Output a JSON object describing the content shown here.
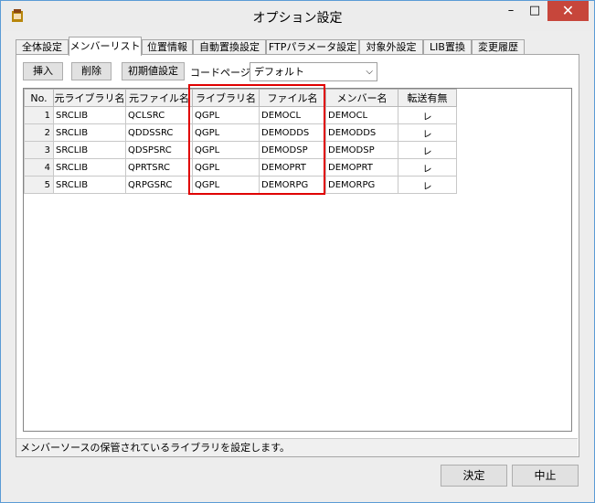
{
  "window": {
    "title": "オプション設定",
    "minimize": "–",
    "maximize": "□",
    "close": "✕"
  },
  "tabs": [
    {
      "label": "全体設定",
      "active": false
    },
    {
      "label": "メンバーリスト",
      "active": true
    },
    {
      "label": "位置情報",
      "active": false
    },
    {
      "label": "自動置換設定",
      "active": false
    },
    {
      "label": "FTPパラメータ設定",
      "active": false
    },
    {
      "label": "対象外設定",
      "active": false
    },
    {
      "label": "LIB置換",
      "active": false
    },
    {
      "label": "変更履歴",
      "active": false
    }
  ],
  "toolbar": {
    "insert_label": "挿入",
    "delete_label": "削除",
    "init_label": "初期値設定",
    "codepage_label": "コードページ",
    "codepage_value": "デフォルト"
  },
  "grid": {
    "columns": [
      "No.",
      "元ライブラリ名",
      "元ファイル名",
      "ライブラリ名",
      "ファイル名",
      "メンバー名",
      "転送有無"
    ],
    "rows": [
      [
        "1",
        "SRCLIB",
        "QCLSRC",
        "QGPL",
        "DEMOCL",
        "DEMOCL",
        "レ"
      ],
      [
        "2",
        "SRCLIB",
        "QDDSSRC",
        "QGPL",
        "DEMODDS",
        "DEMODDS",
        "レ"
      ],
      [
        "3",
        "SRCLIB",
        "QDSPSRC",
        "QGPL",
        "DEMODSP",
        "DEMODSP",
        "レ"
      ],
      [
        "4",
        "SRCLIB",
        "QPRTSRC",
        "QGPL",
        "DEMOPRT",
        "DEMOPRT",
        "レ"
      ],
      [
        "5",
        "SRCLIB",
        "QRPGSRC",
        "QGPL",
        "DEMORPG",
        "DEMORPG",
        "レ"
      ]
    ]
  },
  "status": {
    "text": "メンバーソースの保管されているライブラリを設定します。"
  },
  "footer": {
    "ok_label": "決定",
    "cancel_label": "中止"
  },
  "colors": {
    "highlight": "#e00000",
    "close_button": "#c7463b"
  }
}
